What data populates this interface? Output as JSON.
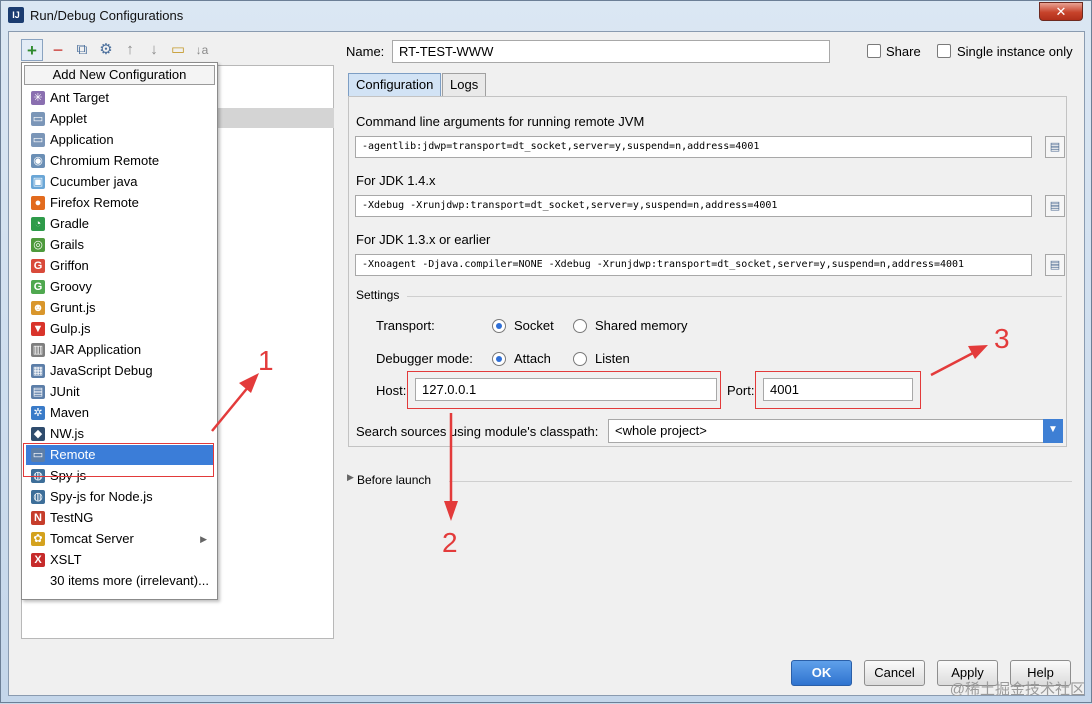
{
  "window": {
    "title": "Run/Debug Configurations",
    "app_icon": "IJ",
    "close": "✕"
  },
  "toolbar": {
    "icons": [
      "add-icon",
      "remove-icon",
      "copy-icon",
      "wrench-icon",
      "move-up-icon",
      "move-down-icon",
      "folder-icon",
      "sort-icon"
    ],
    "add": "+",
    "remove": "−",
    "copy": "⧉",
    "edit": "⚙",
    "up": "↑",
    "down": "↓",
    "folder": "▭",
    "sort": "↓a"
  },
  "menu": {
    "header": "Add New Configuration",
    "items": [
      {
        "label": "Ant Target",
        "icon": "ant-icon",
        "glyph": "✳",
        "color": "#8a6fb0"
      },
      {
        "label": "Applet",
        "icon": "applet-icon",
        "glyph": "▭",
        "color": "#7b96b8"
      },
      {
        "label": "Application",
        "icon": "application-icon",
        "glyph": "▭",
        "color": "#7b96b8"
      },
      {
        "label": "Chromium Remote",
        "icon": "chromium-icon",
        "glyph": "◉",
        "color": "#6b8fb5"
      },
      {
        "label": "Cucumber java",
        "icon": "cucumber-icon",
        "glyph": "▣",
        "color": "#6aa6d6"
      },
      {
        "label": "Firefox Remote",
        "icon": "firefox-icon",
        "glyph": "●",
        "color": "#e26b1e"
      },
      {
        "label": "Gradle",
        "icon": "gradle-icon",
        "glyph": "◔",
        "color": "#2f9b4a"
      },
      {
        "label": "Grails",
        "icon": "grails-icon",
        "glyph": "◎",
        "color": "#4e9a3c"
      },
      {
        "label": "Griffon",
        "icon": "griffon-icon",
        "glyph": "G",
        "color": "#d94a3a"
      },
      {
        "label": "Groovy",
        "icon": "groovy-icon",
        "glyph": "G",
        "color": "#4fa84f"
      },
      {
        "label": "Grunt.js",
        "icon": "grunt-icon",
        "glyph": "☻",
        "color": "#d9962b"
      },
      {
        "label": "Gulp.js",
        "icon": "gulp-icon",
        "glyph": "▼",
        "color": "#d9342b"
      },
      {
        "label": "JAR Application",
        "icon": "jar-icon",
        "glyph": "▥",
        "color": "#7f7f7f"
      },
      {
        "label": "JavaScript Debug",
        "icon": "js-debug-icon",
        "glyph": "▦",
        "color": "#5c7ea8"
      },
      {
        "label": "JUnit",
        "icon": "junit-icon",
        "glyph": "▤",
        "color": "#5c7ea8"
      },
      {
        "label": "Maven",
        "icon": "maven-icon",
        "glyph": "✲",
        "color": "#3a7bc8"
      },
      {
        "label": "NW.js",
        "icon": "nwjs-icon",
        "glyph": "◆",
        "color": "#2f4c6d"
      },
      {
        "label": "Remote",
        "icon": "remote-icon",
        "glyph": "▭",
        "color": "#5c7ea8"
      },
      {
        "label": "Spy-js",
        "icon": "spyjs-icon",
        "glyph": "◍",
        "color": "#3d6e99"
      },
      {
        "label": "Spy-js for Node.js",
        "icon": "spyjs-node-icon",
        "glyph": "◍",
        "color": "#3d6e99"
      },
      {
        "label": "TestNG",
        "icon": "testng-icon",
        "glyph": "N",
        "color": "#c63d2b"
      },
      {
        "label": "Tomcat Server",
        "icon": "tomcat-icon",
        "glyph": "✿",
        "color": "#d4a21e"
      },
      {
        "label": "XSLT",
        "icon": "xslt-icon",
        "glyph": "X",
        "color": "#c62b2b"
      },
      {
        "label": "30 items more (irrelevant)...",
        "icon": "",
        "glyph": "",
        "color": ""
      }
    ],
    "selected_index": 17,
    "submenu_arrow": "▶"
  },
  "name_row": {
    "label": "Name:",
    "value": "RT-TEST-WWW",
    "share": "Share",
    "single_instance": "Single instance only"
  },
  "tabs": [
    "Configuration",
    "Logs"
  ],
  "config": {
    "cmd_label": "Command line arguments for running remote JVM",
    "cmd_value": "-agentlib:jdwp=transport=dt_socket,server=y,suspend=n,address=4001",
    "jdk14_label": "For JDK 1.4.x",
    "jdk14_value": "-Xdebug -Xrunjdwp:transport=dt_socket,server=y,suspend=n,address=4001",
    "jdk13_label": "For JDK 1.3.x or earlier",
    "jdk13_value": "-Xnoagent -Djava.compiler=NONE -Xdebug -Xrunjdwp:transport=dt_socket,server=y,suspend=n,address=4001",
    "settings_label": "Settings",
    "transport_label": "Transport:",
    "socket": "Socket",
    "shared_memory": "Shared memory",
    "debugger_mode_label": "Debugger mode:",
    "attach": "Attach",
    "listen": "Listen",
    "host_label": "Host:",
    "host_value": "127.0.0.1",
    "port_label": "Port:",
    "port_value": "4001",
    "search_label": "Search sources using module's classpath:",
    "search_value": "<whole project>"
  },
  "before_launch": "Before launch",
  "buttons": {
    "ok": "OK",
    "cancel": "Cancel",
    "apply": "Apply",
    "help": "Help"
  },
  "annotations": {
    "n1": "1",
    "n2": "2",
    "n3": "3",
    "color": "#e33b3b"
  },
  "watermark": "@稀土掘金技术社区"
}
